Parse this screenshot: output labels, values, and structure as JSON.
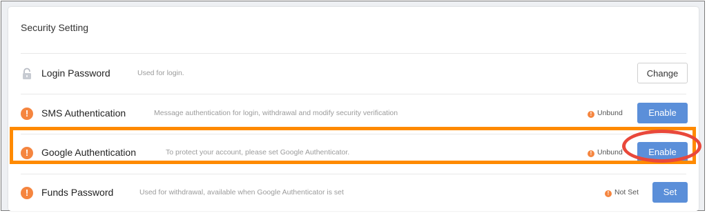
{
  "card": {
    "title": "Security Setting"
  },
  "rows": [
    {
      "name": "Login Password",
      "desc": "Used for login.",
      "status": "",
      "button": "Change",
      "icon": "lock-icon"
    },
    {
      "name": "SMS Authentication",
      "desc": "Message authentication for login, withdrawal and modify security verification",
      "status": "Unbund",
      "button": "Enable",
      "icon": "warning-icon"
    },
    {
      "name": "Google Authentication",
      "desc": "To protect your account, please set Google Authenticator.",
      "status": "Unbund",
      "button": "Enable",
      "icon": "warning-icon"
    },
    {
      "name": "Funds Password",
      "desc": "Used for withdrawal, available when Google Authenticator is set",
      "status": "Not Set",
      "button": "Set",
      "icon": "warning-icon"
    }
  ],
  "glyphs": {
    "warning": "!"
  },
  "colors": {
    "accent_button": "#5b8fd9",
    "warning": "#f5853f",
    "highlight_box": "#ff8a00",
    "highlight_circle": "#e9483b"
  }
}
